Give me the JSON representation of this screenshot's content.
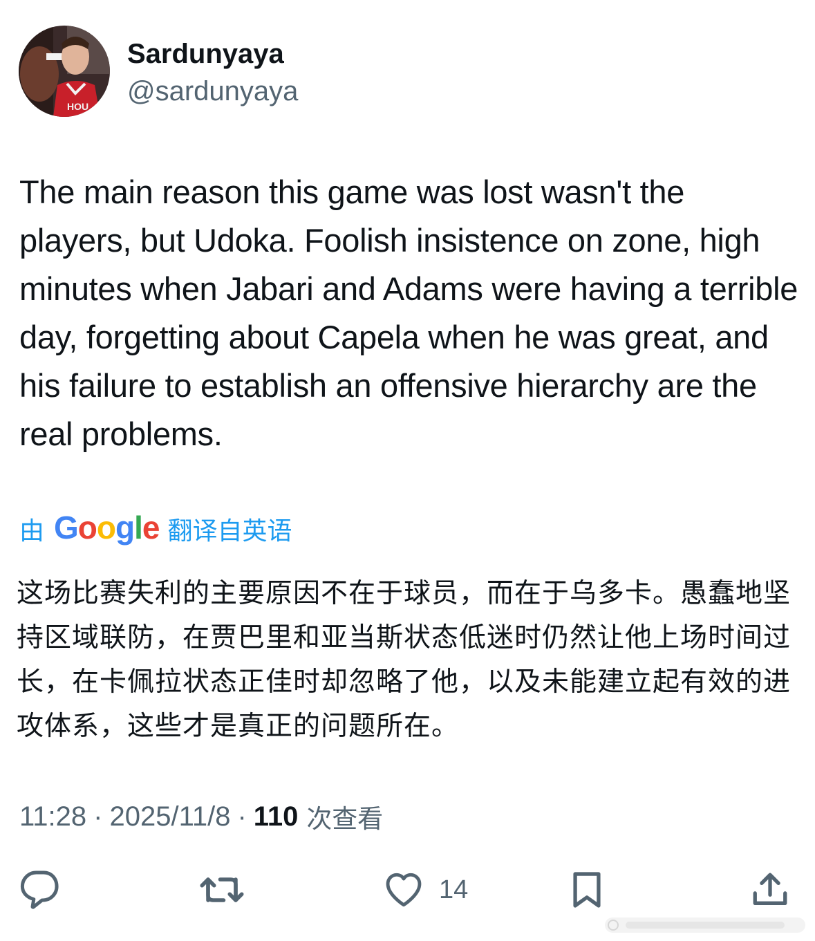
{
  "author": {
    "display_name": "Sardunyaya",
    "handle": "@sardunyaya",
    "avatar_icon": "profile-photo-basketball-player"
  },
  "tweet": {
    "text": "The main reason this game was lost wasn't the players, but Udoka. Foolish insistence on zone, high minutes when Jabari and Adams were having a terrible day, forgetting about Capela when he was great, and his failure to establish an offensive hierarchy are the real problems."
  },
  "translation": {
    "prefix": "由",
    "provider": "Google",
    "suffix": "翻译自英语",
    "text": "这场比赛失利的主要原因不在于球员，而在于乌多卡。愚蠢地坚持区域联防，在贾巴里和亚当斯状态低迷时仍然让他上场时间过长，在卡佩拉状态正佳时却忽略了他，以及未能建立起有效的进攻体系，这些才是真正的问题所在。",
    "brand_colors": {
      "blue": "#4285f4",
      "red": "#ea4335",
      "yellow": "#fbbc05",
      "green": "#34a853"
    }
  },
  "meta": {
    "time": "11:28",
    "separator": "·",
    "date": "2025/11/8",
    "views_count": "110",
    "views_label": "次查看"
  },
  "actions": {
    "reply_icon": "reply-icon",
    "retweet_icon": "retweet-icon",
    "like_icon": "heart-icon",
    "like_count": "14",
    "bookmark_icon": "bookmark-icon",
    "share_icon": "share-icon"
  },
  "colors": {
    "text_primary": "#0f1419",
    "text_secondary": "#536471",
    "accent": "#1d9bf0"
  }
}
